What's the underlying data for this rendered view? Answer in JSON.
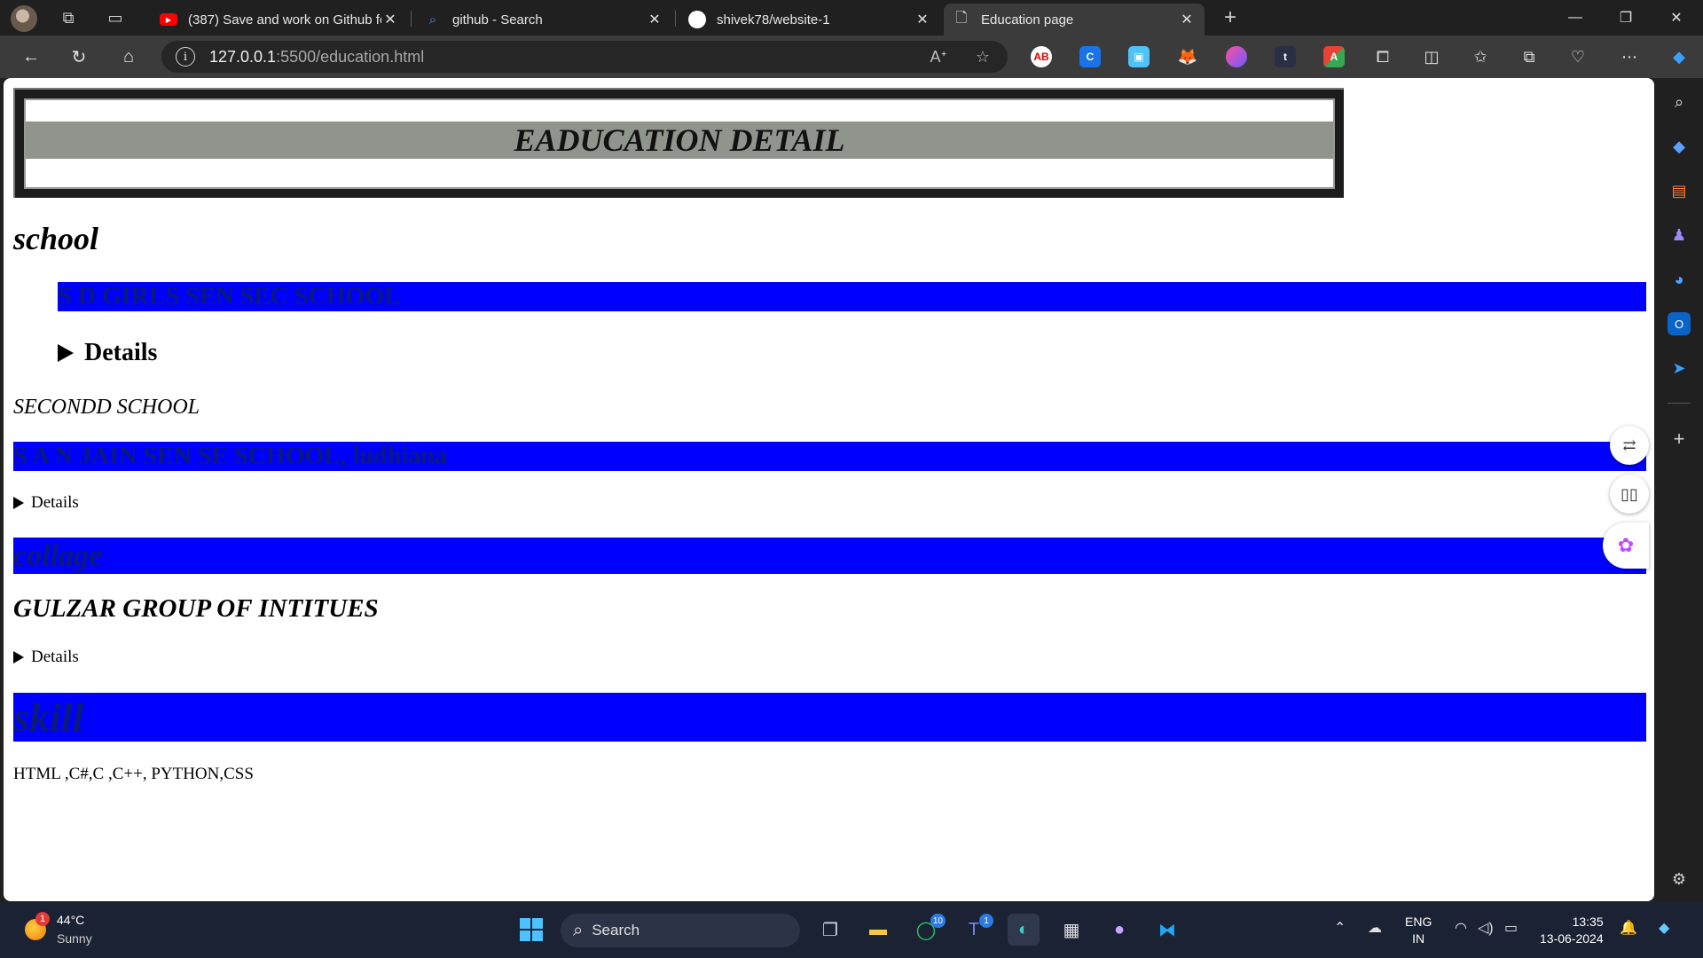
{
  "browser": {
    "tabs": [
      {
        "title": "(387) Save and work on Github fo",
        "favicon": "youtube-icon",
        "active": false
      },
      {
        "title": "github - Search",
        "favicon": "search-icon",
        "active": false
      },
      {
        "title": "shivek78/website-1",
        "favicon": "github-icon",
        "active": false
      },
      {
        "title": "Education page",
        "favicon": "page-icon",
        "active": true
      }
    ],
    "address": {
      "host": "127.0.0.1",
      "path": ":5500/education.html"
    },
    "colors": {
      "accent_blue": "#0000ff",
      "banner_grey": "#8f948d"
    }
  },
  "page": {
    "banner_title": "EADUCATION DETAIL",
    "school_heading": "school",
    "school_name": "S D GIRLS SEN SEC SCHOOL",
    "details_big": "Details",
    "second_label": "SECONDD SCHOOL",
    "second_school": "S A N JAIN SEN SE SCHOOL, ludhiana",
    "details_1": "Details",
    "college_heading": "collage",
    "college_name": "GULZAR GROUP OF INTITUES",
    "details_2": "Details",
    "skill_heading": "skill",
    "skills": "HTML ,C#,C ,C++, PYTHON,CSS"
  },
  "taskbar": {
    "weather": {
      "temp": "44°C",
      "condition": "Sunny",
      "badge": "1"
    },
    "search_label": "Search",
    "whatsapp_badge": "10",
    "teams_badge": "1",
    "lang": {
      "line1": "ENG",
      "line2": "IN"
    },
    "clock": {
      "time": "13:35",
      "date": "13-06-2024"
    }
  }
}
